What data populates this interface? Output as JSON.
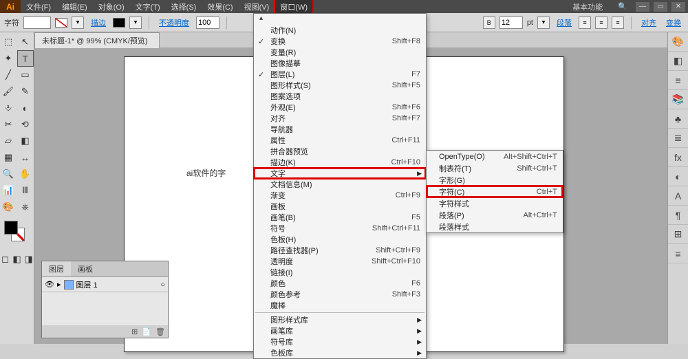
{
  "app": {
    "icon": "Ai",
    "workspace": "基本功能"
  },
  "menu": {
    "items": [
      "文件(F)",
      "编辑(E)",
      "对象(O)",
      "文字(T)",
      "选择(S)",
      "效果(C)",
      "视图(V)",
      "窗口(W)"
    ],
    "active_index": 7
  },
  "options": {
    "label": "字符",
    "stroke": "描边",
    "opacity_label": "不透明度",
    "opacity_value": "100",
    "pt_value": "12",
    "pt_unit": "pt",
    "align_label": "段落",
    "align_group": "对齐",
    "transform": "变换"
  },
  "document": {
    "tab": "未标题-1* @ 99% (CMYK/预览)",
    "canvas_text": "ai软件的字"
  },
  "layers": {
    "tabs": [
      "图层",
      "画板"
    ],
    "row": "图层 1"
  },
  "window_menu": [
    {
      "type": "top"
    },
    {
      "label": "动作(N)"
    },
    {
      "label": "变换",
      "shortcut": "Shift+F8",
      "check": true
    },
    {
      "label": "变量(R)"
    },
    {
      "label": "图像描摹"
    },
    {
      "label": "图层(L)",
      "shortcut": "F7",
      "check": true
    },
    {
      "label": "图形样式(S)",
      "shortcut": "Shift+F5"
    },
    {
      "label": "图案选项"
    },
    {
      "label": "外观(E)",
      "shortcut": "Shift+F6"
    },
    {
      "label": "对齐",
      "shortcut": "Shift+F7"
    },
    {
      "label": "导航器"
    },
    {
      "label": "属性",
      "shortcut": "Ctrl+F11"
    },
    {
      "label": "拼合器预览"
    },
    {
      "label": "描边(K)",
      "shortcut": "Ctrl+F10"
    },
    {
      "label": "文字",
      "arrow": true,
      "boxed": true
    },
    {
      "label": "文档信息(M)"
    },
    {
      "label": "渐变",
      "shortcut": "Ctrl+F9"
    },
    {
      "label": "画板"
    },
    {
      "label": "画笔(B)",
      "shortcut": "F5"
    },
    {
      "label": "符号",
      "shortcut": "Shift+Ctrl+F11"
    },
    {
      "label": "色板(H)"
    },
    {
      "label": "路径查找器(P)",
      "shortcut": "Shift+Ctrl+F9"
    },
    {
      "label": "透明度",
      "shortcut": "Shift+Ctrl+F10"
    },
    {
      "label": "链接(I)"
    },
    {
      "label": "颜色",
      "shortcut": "F6"
    },
    {
      "label": "颜色参考",
      "shortcut": "Shift+F3"
    },
    {
      "label": "魔棒"
    },
    {
      "sep": true
    },
    {
      "label": "图形样式库",
      "arrow": true
    },
    {
      "label": "画笔库",
      "arrow": true
    },
    {
      "label": "符号库",
      "arrow": true
    },
    {
      "label": "色板库",
      "arrow": true
    }
  ],
  "text_submenu": [
    {
      "label": "OpenType(O)",
      "shortcut": "Alt+Shift+Ctrl+T"
    },
    {
      "label": "制表符(T)",
      "shortcut": "Shift+Ctrl+T"
    },
    {
      "label": "字形(G)"
    },
    {
      "label": "字符(C)",
      "shortcut": "Ctrl+T",
      "boxed": true
    },
    {
      "label": "字符样式"
    },
    {
      "label": "段落(P)",
      "shortcut": "Alt+Ctrl+T"
    },
    {
      "label": "段落样式"
    }
  ],
  "tools": [
    "⬚",
    "↖",
    "✦",
    "T",
    "╱",
    "▭",
    "🖌",
    "✎",
    "⎀",
    "◐",
    "✂",
    "⟲",
    "▱",
    "◧",
    "▦",
    "↔",
    "🔍",
    "✋",
    "📊",
    "Ⅲ",
    "🎨",
    "⎈"
  ],
  "dock_icons": [
    "🎨",
    "◧",
    "≡",
    "📚",
    "♣",
    "≣",
    "fx",
    "◐",
    "A",
    "¶",
    "⊞",
    "≡"
  ]
}
